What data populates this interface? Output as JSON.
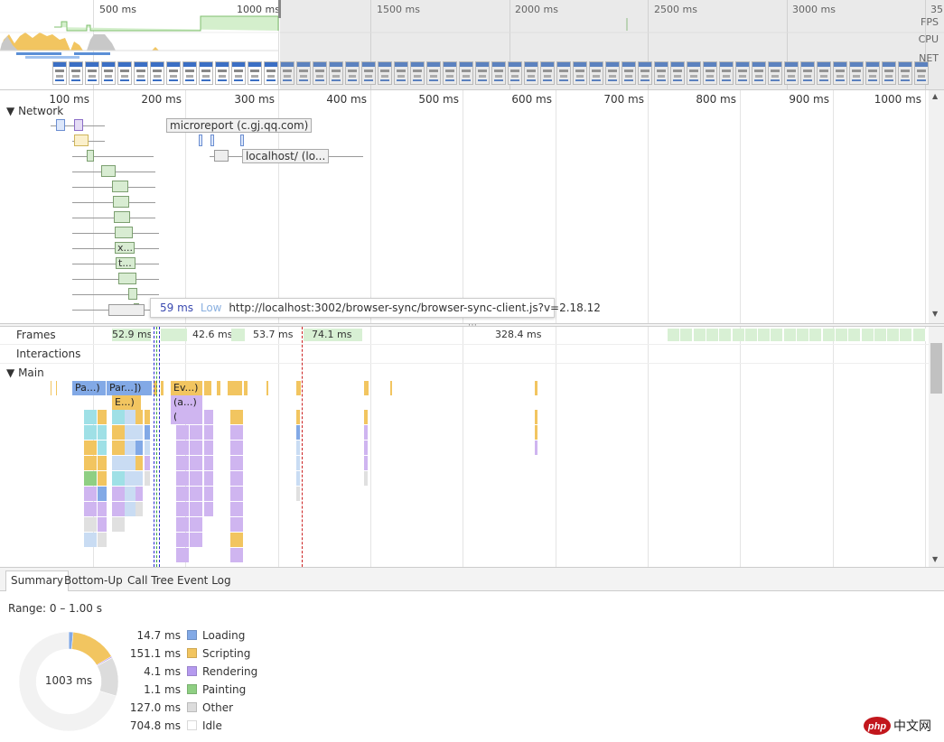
{
  "overview": {
    "ticks": [
      "500 ms",
      "1000 ms",
      "1500 ms",
      "2000 ms",
      "2500 ms",
      "3000 ms",
      "35"
    ],
    "lanes": [
      "FPS",
      "CPU",
      "NET"
    ]
  },
  "network": {
    "section_label": "Network",
    "ticks": [
      "100 ms",
      "200 ms",
      "300 ms",
      "400 ms",
      "500 ms",
      "600 ms",
      "700 ms",
      "800 ms",
      "900 ms",
      "1000 ms"
    ],
    "labels": {
      "microreport": "microreport (c.gj.qq.com)",
      "localhost": "localhost/ (lo...",
      "x_item": "x...",
      "t_item": "t..."
    },
    "tooltip": {
      "duration": "59 ms",
      "priority": "Low",
      "url": "http://localhost:3002/browser-sync/browser-sync-client.js?v=2.18.12"
    }
  },
  "flame": {
    "frames_label": "Frames",
    "interactions_label": "Interactions",
    "main_label": "Main",
    "frame_durations": [
      "52.9 ms",
      "42.6 ms",
      "53.7 ms",
      "74.1 ms",
      "328.4 ms"
    ],
    "entries": {
      "pa": "Pa...)",
      "par": "Par...])",
      "ev": "Ev...)",
      "e": "E...)",
      "a": "(a...)",
      "paren": "(..."
    },
    "colors": {
      "loading": "#82a9e6",
      "scripting": "#f2c560",
      "rendering": "#cfb5f0",
      "painting": "#8fcf83",
      "other": "#dcdcdc",
      "idle": "#ffffff"
    }
  },
  "tabs": [
    "Summary",
    "Bottom-Up",
    "Call Tree",
    "Event Log"
  ],
  "summary": {
    "range": "Range: 0 – 1.00 s",
    "total": "1003 ms",
    "rows": [
      {
        "value": "14.7 ms",
        "name": "Loading",
        "color": "#82a9e6"
      },
      {
        "value": "151.1 ms",
        "name": "Scripting",
        "color": "#f2c560"
      },
      {
        "value": "4.1 ms",
        "name": "Rendering",
        "color": "#b59aef"
      },
      {
        "value": "1.1 ms",
        "name": "Painting",
        "color": "#8fcf83"
      },
      {
        "value": "127.0 ms",
        "name": "Other",
        "color": "#dcdcdc"
      },
      {
        "value": "704.8 ms",
        "name": "Idle",
        "color": "#ffffff"
      }
    ]
  },
  "watermark": {
    "text": "中文网",
    "logo": "php"
  }
}
